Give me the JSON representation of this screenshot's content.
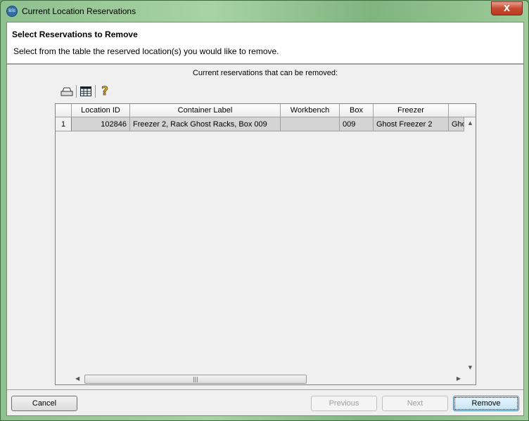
{
  "window": {
    "title": "Current Location Reservations",
    "app_icon_text": "BSI",
    "close_label": "X"
  },
  "header": {
    "title": "Select Reservations to Remove",
    "instructions": "Select from the table the reserved location(s) you would like to remove."
  },
  "caption": "Current reservations that can be removed:",
  "toolbar": {
    "icons": [
      "print-icon",
      "table-icon",
      "help-icon"
    ]
  },
  "table": {
    "columns": [
      "Location ID",
      "Container Label",
      "Workbench",
      "Box",
      "Freezer",
      ""
    ],
    "rows": [
      {
        "num": "1",
        "cells": [
          "102846",
          "Freezer 2, Rack Ghost Racks, Box 009",
          "",
          "009",
          "Ghost Freezer 2",
          "Gho"
        ]
      }
    ]
  },
  "buttons": {
    "cancel": "Cancel",
    "previous": "Previous",
    "next": "Next",
    "remove": "Remove"
  }
}
